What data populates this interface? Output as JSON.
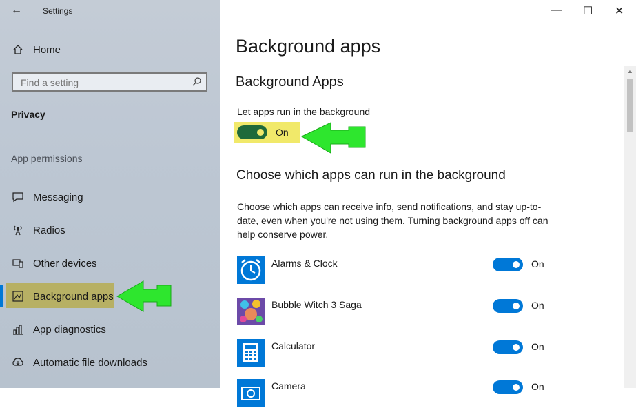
{
  "window": {
    "title": "Settings",
    "back_icon": "arrow-left-icon",
    "minimize_glyph": "—",
    "maximize_glyph": "☐",
    "close_glyph": "✕"
  },
  "sidebar": {
    "home_label": "Home",
    "search_placeholder": "Find a setting",
    "category": "Privacy",
    "section_label": "App permissions",
    "items": [
      {
        "label": "Messaging",
        "icon": "message-icon"
      },
      {
        "label": "Radios",
        "icon": "radio-tower-icon"
      },
      {
        "label": "Other devices",
        "icon": "devices-icon"
      },
      {
        "label": "Background apps",
        "icon": "background-apps-icon",
        "selected": true
      },
      {
        "label": "App diagnostics",
        "icon": "diagnostics-icon"
      },
      {
        "label": "Automatic file downloads",
        "icon": "download-icon"
      }
    ]
  },
  "main": {
    "title": "Background apps",
    "subtitle": "Background Apps",
    "master_toggle_label": "Let apps run in the background",
    "master_toggle_state": "On",
    "choose_heading": "Choose which apps can run in the background",
    "description": "Choose which apps can receive info, send notifications, and stay up-to-date, even when you're not using them. Turning background apps off can help conserve power.",
    "apps": [
      {
        "name": "Alarms & Clock",
        "state": "On",
        "icon": "alarm-clock-icon"
      },
      {
        "name": "Bubble Witch 3 Saga",
        "state": "On",
        "icon": "bubble-witch-icon"
      },
      {
        "name": "Calculator",
        "state": "On",
        "icon": "calculator-icon"
      },
      {
        "name": "Camera",
        "state": "On",
        "icon": "camera-icon"
      }
    ]
  },
  "colors": {
    "accent": "#0078d7",
    "highlight_yellow": "#f1e96a",
    "arrow_green": "#2ee62e"
  }
}
